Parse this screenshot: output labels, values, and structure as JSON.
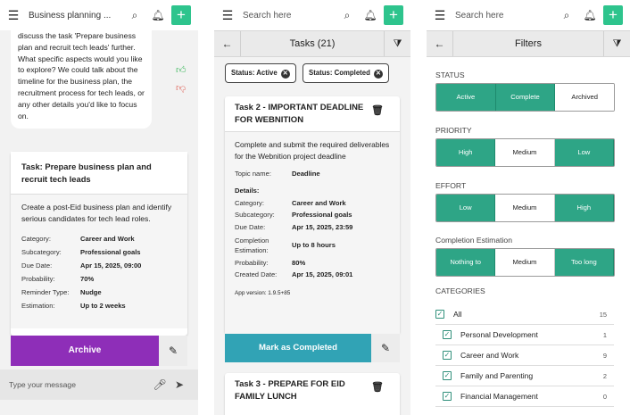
{
  "chat": {
    "app_title": "Business planning ...",
    "bubble_text": "discuss the task 'Prepare business plan and recruit tech leads' further. What specific aspects would you like to explore? We could talk about the timeline for the business plan, the recruitment process for tech leads, or any other details you'd like to focus on.",
    "task": {
      "title": "Task: Prepare business plan and recruit tech leads",
      "description": "Create a post-Eid business plan and identify serious candidates for tech lead roles.",
      "fields": [
        {
          "k": "Category:",
          "v": "Career and Work"
        },
        {
          "k": "Subcategory:",
          "v": "Professional goals"
        },
        {
          "k": "Due Date:",
          "v": "Apr 15, 2025, 09:00"
        },
        {
          "k": "Probability:",
          "v": "70%"
        },
        {
          "k": "Reminder Type:",
          "v": "Nudge"
        },
        {
          "k": "Estimation:",
          "v": "Up to 2 weeks"
        }
      ]
    },
    "archive_label": "Archive",
    "message_placeholder": "Type your message"
  },
  "tasks": {
    "search_placeholder": "Search here",
    "title": "Tasks (21)",
    "chips": [
      "Status: Active",
      "Status: Completed"
    ],
    "task2": {
      "title": "Task 2 - IMPORTANT DEADLINE FOR WEBNITION",
      "description": "Complete and submit the required deliverables for the Webnition project deadline",
      "topic_k": "Topic name:",
      "topic_v": "Deadline",
      "details_label": "Details:",
      "fields": [
        {
          "k": "Category:",
          "v": "Career and Work"
        },
        {
          "k": "Subcategory:",
          "v": "Professional goals"
        },
        {
          "k": "Due Date:",
          "v": "Apr 15, 2025, 23:59"
        },
        {
          "k": "Completion Estimation:",
          "v": "Up to 8 hours"
        },
        {
          "k": "Probability:",
          "v": "80%"
        },
        {
          "k": "Created Date:",
          "v": "Apr 15, 2025, 09:01"
        }
      ],
      "app_version": "App version:  1.9.5+85"
    },
    "mark_completed_label": "Mark as Completed",
    "task3_title": "Task 3 - PREPARE FOR EID FAMILY LUNCH"
  },
  "filters": {
    "search_placeholder": "Search here",
    "title": "Filters",
    "status_label": "STATUS",
    "status_options": [
      {
        "label": "Active",
        "on": true
      },
      {
        "label": "Complete",
        "on": true
      },
      {
        "label": "Archived",
        "on": false
      }
    ],
    "priority_label": "PRIORITY",
    "priority_options": [
      {
        "label": "High",
        "on": true
      },
      {
        "label": "Medium",
        "on": false
      },
      {
        "label": "Low",
        "on": true
      }
    ],
    "effort_label": "EFFORT",
    "effort_options": [
      {
        "label": "Low",
        "on": true
      },
      {
        "label": "Medium",
        "on": false
      },
      {
        "label": "High",
        "on": true
      }
    ],
    "completion_label": "Completion Estimation",
    "completion_options": [
      {
        "label": "Nothing to",
        "on": true
      },
      {
        "label": "Medium",
        "on": false
      },
      {
        "label": "Too long",
        "on": true
      }
    ],
    "categories_label": "CATEGORIES",
    "categories": [
      {
        "name": "All",
        "count": "15"
      },
      {
        "name": "Personal Development",
        "count": "1"
      },
      {
        "name": "Career and Work",
        "count": "9"
      },
      {
        "name": "Family and Parenting",
        "count": "2"
      },
      {
        "name": "Financial Management",
        "count": "0"
      }
    ]
  },
  "colors": {
    "accent": "#2ec48d",
    "archive": "#8e2eb8",
    "mark": "#31a3b5",
    "segment_on": "#2ea586"
  },
  "icons": [
    "menu-icon",
    "search-icon",
    "bell-icon",
    "plus-icon",
    "back-arrow-icon",
    "filter-icon",
    "trash-icon",
    "pencil-icon",
    "microphone-icon",
    "send-icon",
    "thumbs-up-icon",
    "thumbs-down-icon",
    "close-circle-icon",
    "checkbox-icon"
  ]
}
